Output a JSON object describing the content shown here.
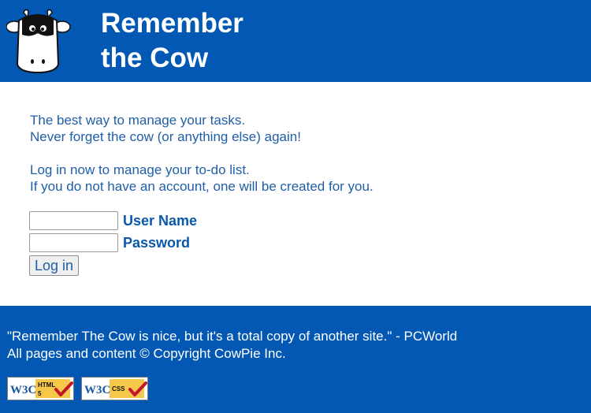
{
  "header": {
    "brand_line1": "Remember",
    "brand_line2": "the Cow",
    "logo_icon": "cow-logo-icon"
  },
  "intro": {
    "line1": "The best way to manage your tasks.",
    "line2": "Never forget the cow (or anything else) again!",
    "line3": "Log in now to manage your to-do list.",
    "line4": "If you do not have an account, one will be created for you."
  },
  "login": {
    "username_label": "User Name",
    "username_value": "",
    "password_label": "Password",
    "password_value": "",
    "submit_label": "Log in"
  },
  "footer": {
    "quote": "\"Remember The Cow is nice, but it's a total copy of another site.\" - PCWorld",
    "copyright": "All pages and content © Copyright CowPie Inc.",
    "badges": [
      {
        "logo": "W3C",
        "label_top": "HTML",
        "label_bottom": "5",
        "icon": "w3c-html5-badge-icon"
      },
      {
        "logo": "W3C",
        "label_top": "CSS",
        "label_bottom": "",
        "icon": "w3c-css-badge-icon"
      }
    ]
  },
  "colors": {
    "brand_blue": "#0258b3",
    "text_blue": "#1f5ea8",
    "label_blue": "#0b58a8",
    "white": "#ffffff"
  }
}
